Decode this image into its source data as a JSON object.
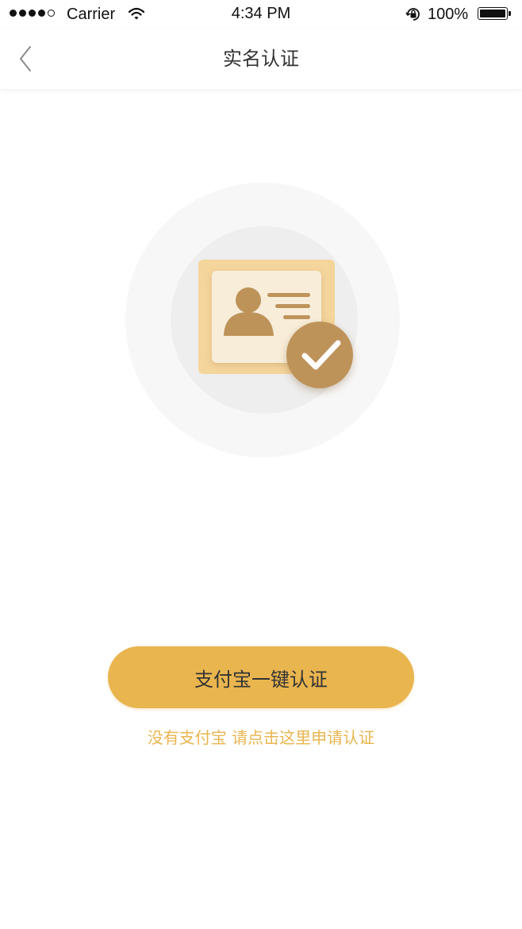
{
  "status_bar": {
    "carrier": "Carrier",
    "time": "4:34 PM",
    "battery": "100%"
  },
  "nav": {
    "back_icon": "chevron-left-icon",
    "title": "实名认证"
  },
  "illustration": {
    "icon": "id-card-verified-icon",
    "colors": {
      "outer_circle": "#f7f7f7",
      "inner_circle": "#eeeeee",
      "card_back": "#f4d59c",
      "card_front": "#f7ecd8",
      "accent": "#be935a"
    }
  },
  "actions": {
    "primary_label": "支付宝一键认证",
    "alt_link_label": "没有支付宝 请点击这里申请认证"
  },
  "colors": {
    "accent": "#e9b54f",
    "title_text": "#333333"
  }
}
